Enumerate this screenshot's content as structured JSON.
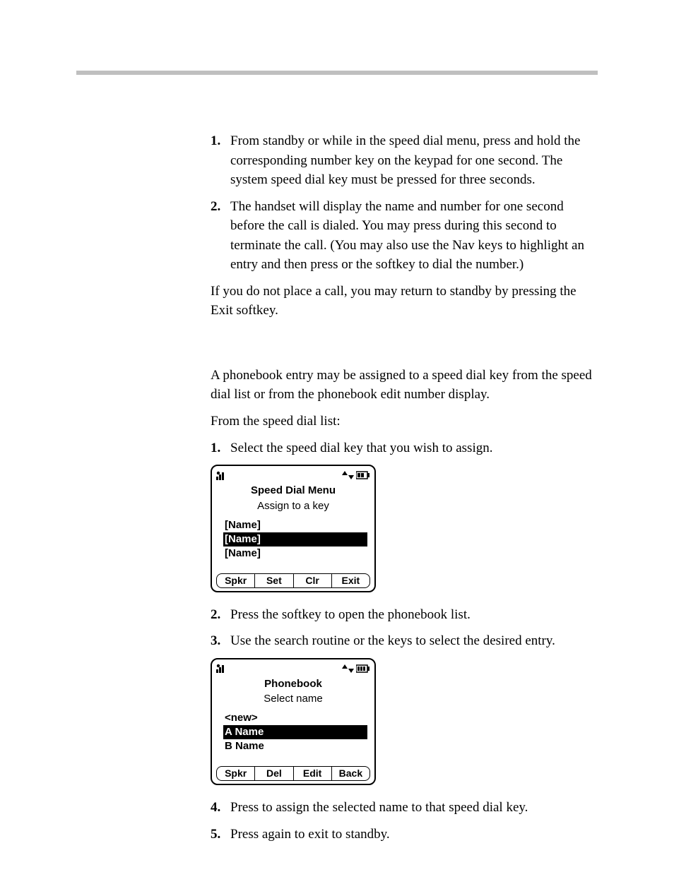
{
  "steps_a": [
    {
      "n": "1.",
      "text": "From standby or while in the speed dial menu, press and hold the corresponding number key on the keypad for one second. The system speed dial key must be pressed for three seconds."
    },
    {
      "n": "2.",
      "text": "The handset will display the name and number for one second before the call is dialed. You may press         during this second to terminate the call. (You may also use the Nav keys to highlight an entry and then press             or the         softkey to dial the number.)"
    }
  ],
  "para_after_a": "If you do not place a call, you may return to standby by pressing the Exit softkey.",
  "para_b1": "A phonebook entry may be assigned to a speed dial key from the speed dial list or from the phonebook edit number display.",
  "para_b2": "From the speed dial list:",
  "steps_b": [
    {
      "n": "1.",
      "text": "Select the speed dial key that you wish to assign."
    }
  ],
  "screen1": {
    "title": "Speed Dial Menu",
    "sub": "Assign to a key",
    "rows": [
      "[Name]",
      "[Name]",
      "[Name]"
    ],
    "sel_index": 1,
    "softkeys": [
      "Spkr",
      "Set",
      "Clr",
      "Exit"
    ]
  },
  "steps_c": [
    {
      "n": "2.",
      "text": "Press the          softkey to open the phonebook list."
    },
    {
      "n": "3.",
      "text": "Use the search routine or the          keys to select the desired entry."
    }
  ],
  "screen2": {
    "title": "Phonebook",
    "sub": "Select name",
    "rows": [
      "<new>",
      "A Name",
      "B Name"
    ],
    "sel_index": 1,
    "softkeys": [
      "Spkr",
      "Del",
      "Edit",
      "Back"
    ]
  },
  "steps_d": [
    {
      "n": "4.",
      "text": "Press               to assign the selected name to that speed dial key."
    },
    {
      "n": "5.",
      "text": "Press               again to exit to standby."
    }
  ]
}
